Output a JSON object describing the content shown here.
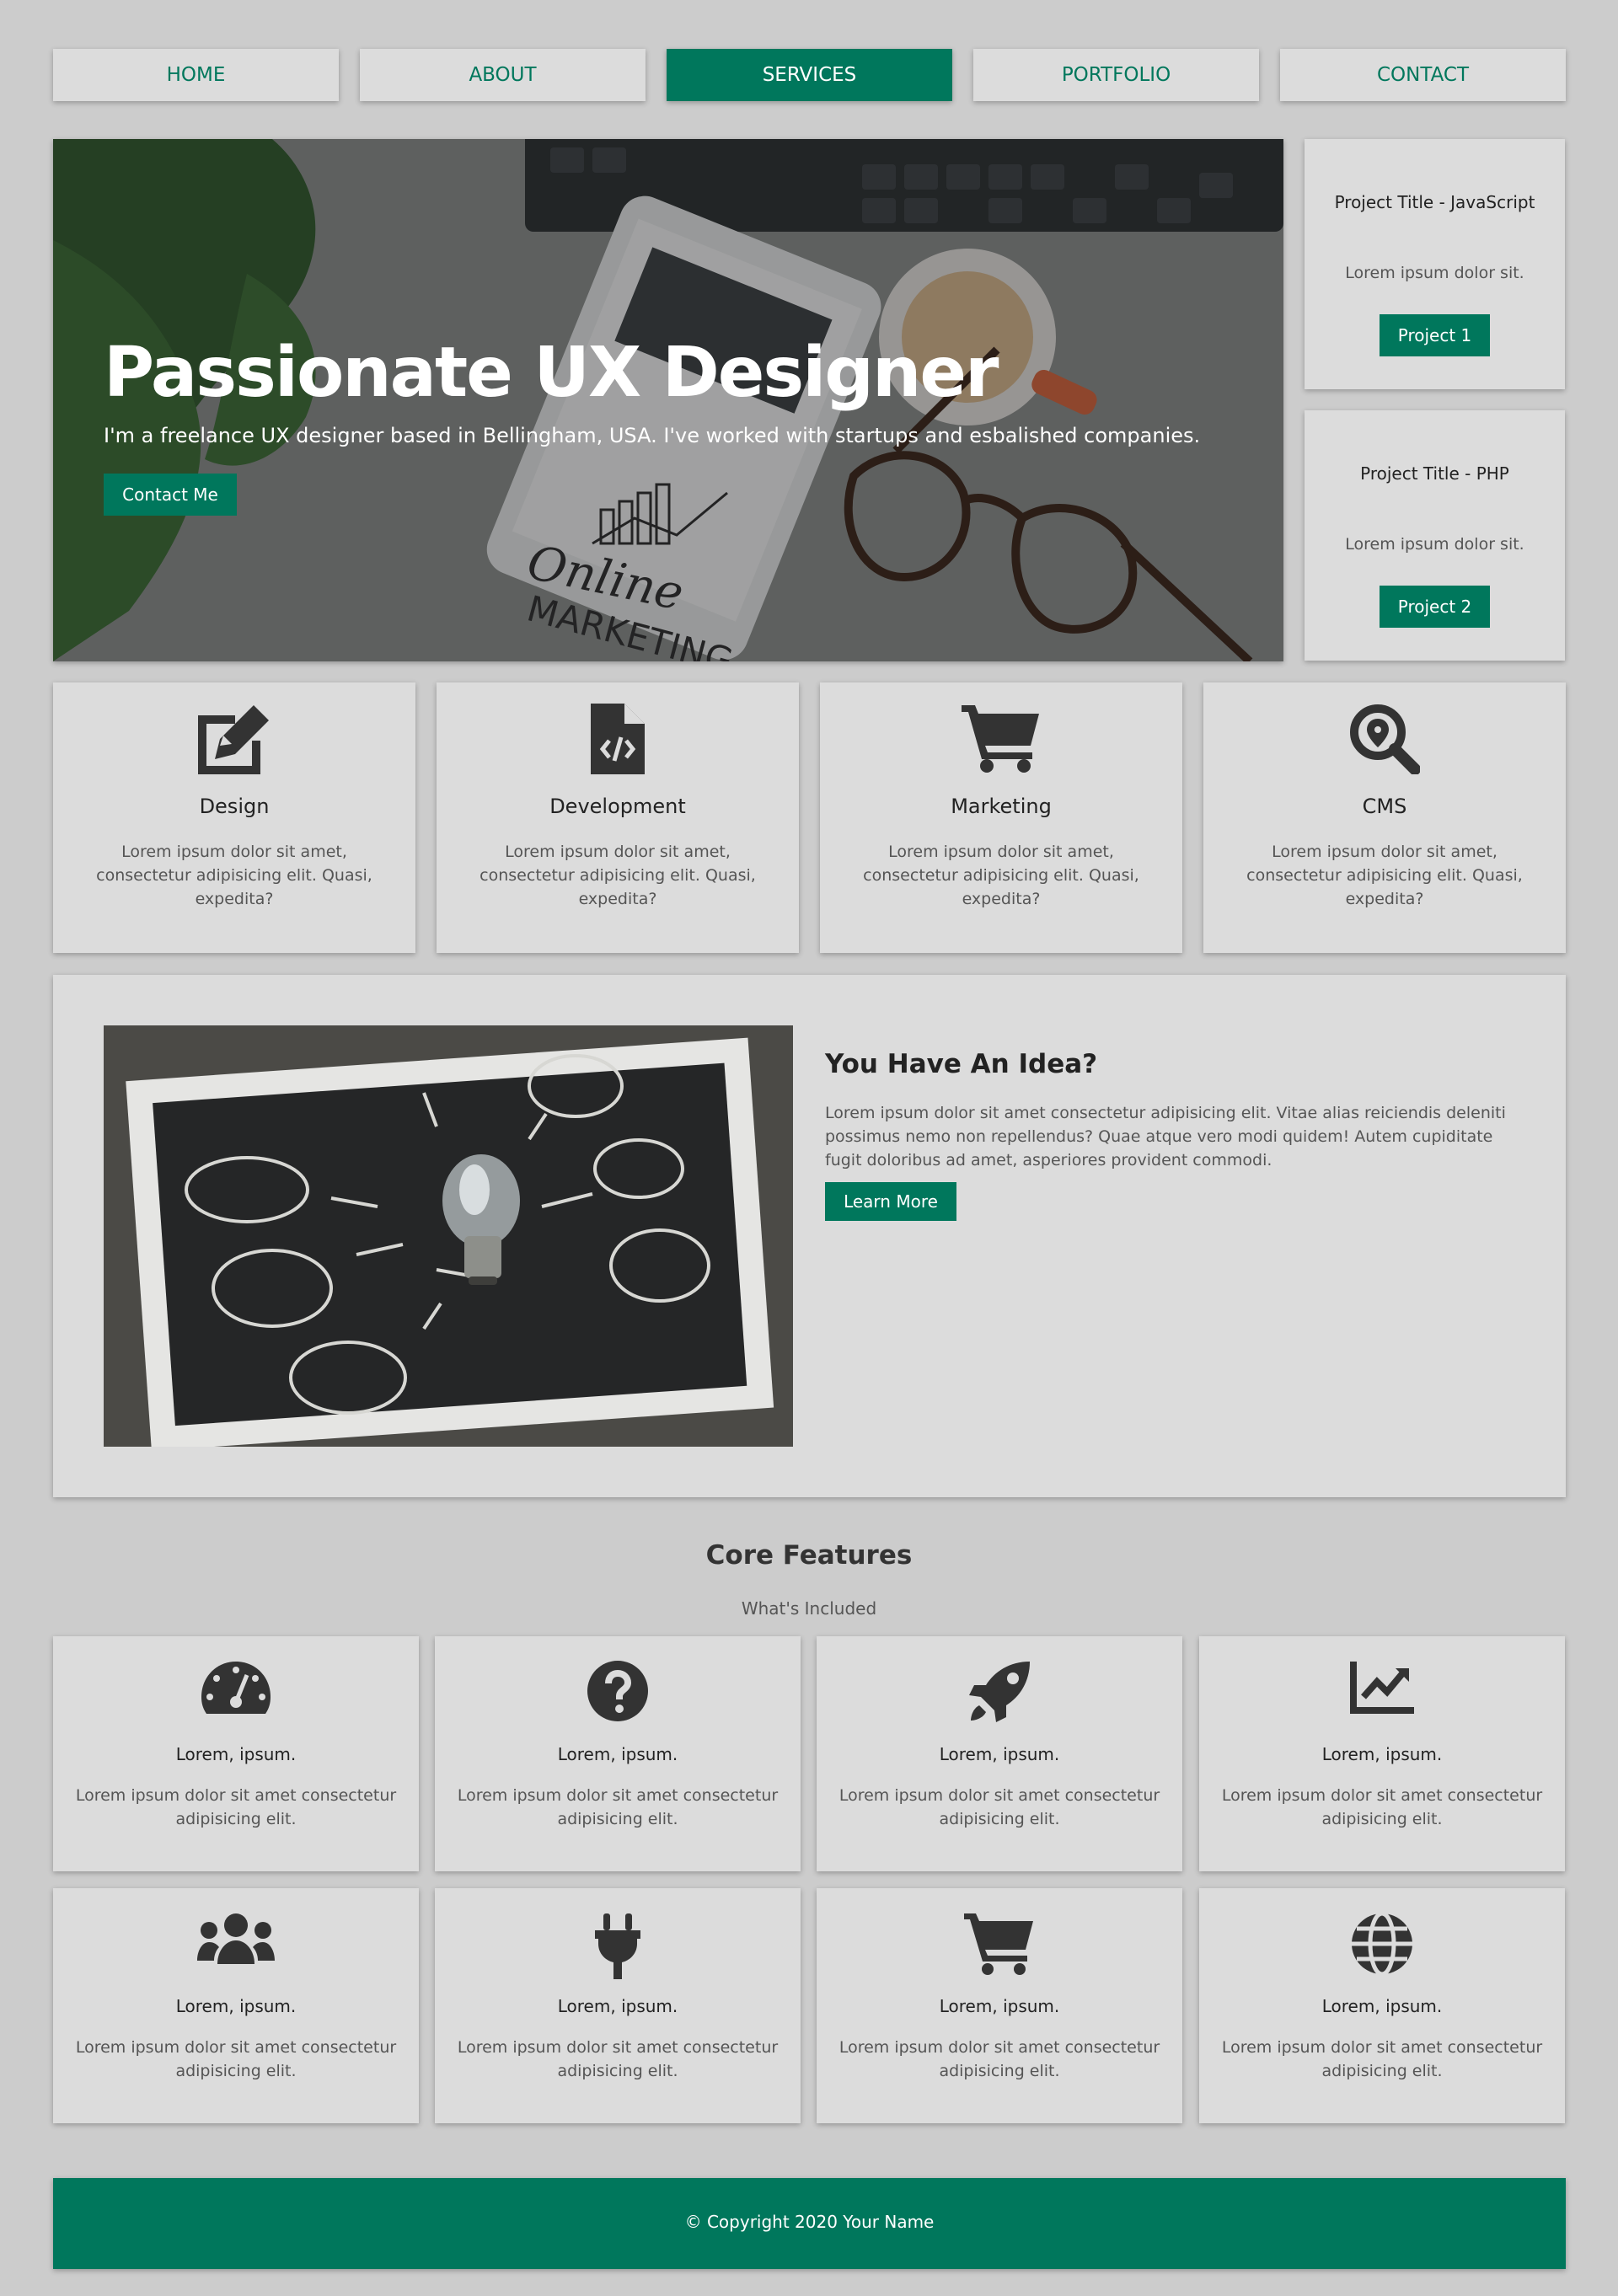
{
  "nav": {
    "items": [
      {
        "label": "HOME"
      },
      {
        "label": "ABOUT"
      },
      {
        "label": "SERVICES"
      },
      {
        "label": "PORTFOLIO"
      },
      {
        "label": "CONTACT"
      }
    ],
    "active_index": 2
  },
  "hero": {
    "title": "Passionate UX Designer",
    "subtitle": "I'm a freelance UX designer based in Bellingham, USA. I've worked with startups and esbalished companies.",
    "button_label": "Contact Me",
    "image_text": [
      "Online",
      "MARKETING"
    ]
  },
  "projects": [
    {
      "title": "Project Title - JavaScript",
      "text": "Lorem ipsum dolor sit.",
      "button_label": "Project 1"
    },
    {
      "title": "Project Title - PHP",
      "text": "Lorem ipsum dolor sit.",
      "button_label": "Project 2"
    }
  ],
  "services": [
    {
      "icon": "edit-icon",
      "title": "Design",
      "text": "Lorem ipsum dolor sit amet, consectetur adipisicing elit. Quasi, expedita?"
    },
    {
      "icon": "file-code-icon",
      "title": "Development",
      "text": "Lorem ipsum dolor sit amet, consectetur adipisicing elit. Quasi, expedita?"
    },
    {
      "icon": "shopping-cart-icon",
      "title": "Marketing",
      "text": "Lorem ipsum dolor sit amet, consectetur adipisicing elit. Quasi, expedita?"
    },
    {
      "icon": "search-location-icon",
      "title": "CMS",
      "text": "Lorem ipsum dolor sit amet, consectetur adipisicing elit. Quasi, expedita?"
    }
  ],
  "idea": {
    "title": "You Have An Idea?",
    "text": "Lorem ipsum dolor sit amet consectetur adipisicing elit. Vitae alias reiciendis deleniti possimus nemo non repellendus? Quae atque vero modi quidem! Autem cupiditate fugit doloribus ad amet, asperiores provident commodi.",
    "button_label": "Learn More"
  },
  "core": {
    "title": "Core Features",
    "subtitle": "What's Included",
    "features": [
      {
        "icon": "tachometer-icon",
        "title": "Lorem, ipsum.",
        "text": "Lorem ipsum dolor sit amet consectetur adipisicing elit."
      },
      {
        "icon": "question-circle-icon",
        "title": "Lorem, ipsum.",
        "text": "Lorem ipsum dolor sit amet consectetur adipisicing elit."
      },
      {
        "icon": "rocket-icon",
        "title": "Lorem, ipsum.",
        "text": "Lorem ipsum dolor sit amet consectetur adipisicing elit."
      },
      {
        "icon": "chart-line-icon",
        "title": "Lorem, ipsum.",
        "text": "Lorem ipsum dolor sit amet consectetur adipisicing elit."
      },
      {
        "icon": "users-icon",
        "title": "Lorem, ipsum.",
        "text": "Lorem ipsum dolor sit amet consectetur adipisicing elit."
      },
      {
        "icon": "plug-icon",
        "title": "Lorem, ipsum.",
        "text": "Lorem ipsum dolor sit amet consectetur adipisicing elit."
      },
      {
        "icon": "shopping-cart-icon",
        "title": "Lorem, ipsum.",
        "text": "Lorem ipsum dolor sit amet consectetur adipisicing elit."
      },
      {
        "icon": "globe-icon",
        "title": "Lorem, ipsum.",
        "text": "Lorem ipsum dolor sit amet consectetur adipisicing elit."
      }
    ]
  },
  "footer": {
    "text": "© Copyright 2020 Your Name"
  },
  "colors": {
    "accent": "#00775c",
    "background": "#cccccc",
    "card": "#dcdcdc",
    "icon": "#333333"
  }
}
